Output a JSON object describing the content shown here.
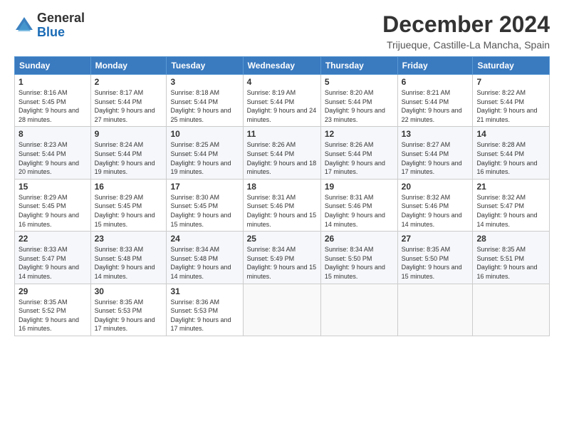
{
  "logo": {
    "general": "General",
    "blue": "Blue"
  },
  "header": {
    "month": "December 2024",
    "location": "Trijueque, Castille-La Mancha, Spain"
  },
  "weekdays": [
    "Sunday",
    "Monday",
    "Tuesday",
    "Wednesday",
    "Thursday",
    "Friday",
    "Saturday"
  ],
  "weeks": [
    [
      {
        "day": "1",
        "sunrise": "8:16 AM",
        "sunset": "5:45 PM",
        "daylight": "9 hours and 28 minutes."
      },
      {
        "day": "2",
        "sunrise": "8:17 AM",
        "sunset": "5:44 PM",
        "daylight": "9 hours and 27 minutes."
      },
      {
        "day": "3",
        "sunrise": "8:18 AM",
        "sunset": "5:44 PM",
        "daylight": "9 hours and 25 minutes."
      },
      {
        "day": "4",
        "sunrise": "8:19 AM",
        "sunset": "5:44 PM",
        "daylight": "9 hours and 24 minutes."
      },
      {
        "day": "5",
        "sunrise": "8:20 AM",
        "sunset": "5:44 PM",
        "daylight": "9 hours and 23 minutes."
      },
      {
        "day": "6",
        "sunrise": "8:21 AM",
        "sunset": "5:44 PM",
        "daylight": "9 hours and 22 minutes."
      },
      {
        "day": "7",
        "sunrise": "8:22 AM",
        "sunset": "5:44 PM",
        "daylight": "9 hours and 21 minutes."
      }
    ],
    [
      {
        "day": "8",
        "sunrise": "8:23 AM",
        "sunset": "5:44 PM",
        "daylight": "9 hours and 20 minutes."
      },
      {
        "day": "9",
        "sunrise": "8:24 AM",
        "sunset": "5:44 PM",
        "daylight": "9 hours and 19 minutes."
      },
      {
        "day": "10",
        "sunrise": "8:25 AM",
        "sunset": "5:44 PM",
        "daylight": "9 hours and 19 minutes."
      },
      {
        "day": "11",
        "sunrise": "8:26 AM",
        "sunset": "5:44 PM",
        "daylight": "9 hours and 18 minutes."
      },
      {
        "day": "12",
        "sunrise": "8:26 AM",
        "sunset": "5:44 PM",
        "daylight": "9 hours and 17 minutes."
      },
      {
        "day": "13",
        "sunrise": "8:27 AM",
        "sunset": "5:44 PM",
        "daylight": "9 hours and 17 minutes."
      },
      {
        "day": "14",
        "sunrise": "8:28 AM",
        "sunset": "5:44 PM",
        "daylight": "9 hours and 16 minutes."
      }
    ],
    [
      {
        "day": "15",
        "sunrise": "8:29 AM",
        "sunset": "5:45 PM",
        "daylight": "9 hours and 16 minutes."
      },
      {
        "day": "16",
        "sunrise": "8:29 AM",
        "sunset": "5:45 PM",
        "daylight": "9 hours and 15 minutes."
      },
      {
        "day": "17",
        "sunrise": "8:30 AM",
        "sunset": "5:45 PM",
        "daylight": "9 hours and 15 minutes."
      },
      {
        "day": "18",
        "sunrise": "8:31 AM",
        "sunset": "5:46 PM",
        "daylight": "9 hours and 15 minutes."
      },
      {
        "day": "19",
        "sunrise": "8:31 AM",
        "sunset": "5:46 PM",
        "daylight": "9 hours and 14 minutes."
      },
      {
        "day": "20",
        "sunrise": "8:32 AM",
        "sunset": "5:46 PM",
        "daylight": "9 hours and 14 minutes."
      },
      {
        "day": "21",
        "sunrise": "8:32 AM",
        "sunset": "5:47 PM",
        "daylight": "9 hours and 14 minutes."
      }
    ],
    [
      {
        "day": "22",
        "sunrise": "8:33 AM",
        "sunset": "5:47 PM",
        "daylight": "9 hours and 14 minutes."
      },
      {
        "day": "23",
        "sunrise": "8:33 AM",
        "sunset": "5:48 PM",
        "daylight": "9 hours and 14 minutes."
      },
      {
        "day": "24",
        "sunrise": "8:34 AM",
        "sunset": "5:48 PM",
        "daylight": "9 hours and 14 minutes."
      },
      {
        "day": "25",
        "sunrise": "8:34 AM",
        "sunset": "5:49 PM",
        "daylight": "9 hours and 15 minutes."
      },
      {
        "day": "26",
        "sunrise": "8:34 AM",
        "sunset": "5:50 PM",
        "daylight": "9 hours and 15 minutes."
      },
      {
        "day": "27",
        "sunrise": "8:35 AM",
        "sunset": "5:50 PM",
        "daylight": "9 hours and 15 minutes."
      },
      {
        "day": "28",
        "sunrise": "8:35 AM",
        "sunset": "5:51 PM",
        "daylight": "9 hours and 16 minutes."
      }
    ],
    [
      {
        "day": "29",
        "sunrise": "8:35 AM",
        "sunset": "5:52 PM",
        "daylight": "9 hours and 16 minutes."
      },
      {
        "day": "30",
        "sunrise": "8:35 AM",
        "sunset": "5:53 PM",
        "daylight": "9 hours and 17 minutes."
      },
      {
        "day": "31",
        "sunrise": "8:36 AM",
        "sunset": "5:53 PM",
        "daylight": "9 hours and 17 minutes."
      },
      null,
      null,
      null,
      null
    ]
  ]
}
